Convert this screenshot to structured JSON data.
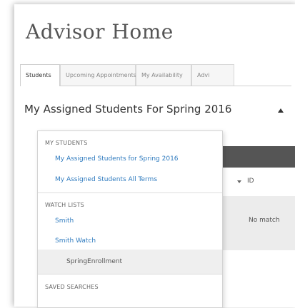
{
  "page": {
    "title": "Advisor Home"
  },
  "tabs": [
    {
      "label": "Students",
      "active": true
    },
    {
      "label": "Upcoming Appointments",
      "active": false
    },
    {
      "label": "My Availability",
      "active": false
    },
    {
      "label": "Advi",
      "active": false
    }
  ],
  "heading": "My Assigned Students For Spring 2016",
  "table": {
    "id_header": "ID",
    "empty_text": "No match"
  },
  "dropdown": {
    "my_students": {
      "label": "MY STUDENTS",
      "items": [
        "My Assigned Students for Spring 2016",
        "My Assigned Students All Terms"
      ]
    },
    "watch_lists": {
      "label": "WATCH LISTS",
      "items": [
        "Smith",
        "Smith Watch",
        "SpringEnrollment"
      ],
      "selected": "SpringEnrollment"
    },
    "saved_searches": {
      "label": "SAVED SEARCHES"
    }
  },
  "colors": {
    "link": "#2f7bbf",
    "table_header": "#555555"
  }
}
